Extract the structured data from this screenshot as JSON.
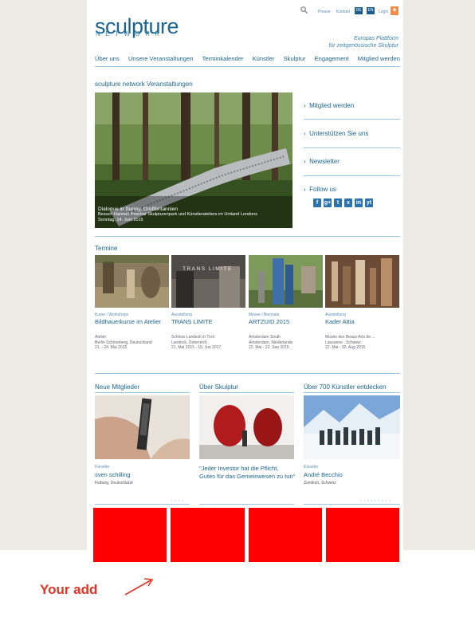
{
  "header": {
    "logo_main": "sculpture",
    "logo_sub": "NETWORK",
    "top_links": [
      "Presse",
      "Kontakt"
    ],
    "lang": [
      "DE",
      "EN"
    ],
    "login": "Login",
    "tagline_line1": "Europas Plattform",
    "tagline_line2": "für zeitgenössische Skulptur"
  },
  "nav": [
    "Über uns",
    "Unsere Veranstaltungen",
    "Terminkalender",
    "Künstler",
    "Skulptur",
    "Engagement",
    "Mitglied werden"
  ],
  "events": {
    "title": "sculpture network Veranstaltungen",
    "hero_title": "Dialogue in Surrey, Großbritannien",
    "hero_desc": "Besuch Hannah Peschar Skulpturenpark und Künstlerateliers im Umland Londons",
    "hero_date": "Sonntag, 14. Juni 2015"
  },
  "sidebar": {
    "items": [
      "Mitglied werden",
      "Unterstützen Sie uns",
      "Newsletter",
      "Follow us"
    ],
    "social": [
      "f",
      "g+",
      "t",
      "x",
      "in",
      "yt"
    ]
  },
  "termine": {
    "title": "Termine",
    "items": [
      {
        "cat": "Kurse / Workshops",
        "title": "Bildhauerkurse im Atelier",
        "meta1": "Atelier",
        "meta2": "Berlin Schöneberg, Deutschland",
        "meta3": "21. - 24. Mai 2015"
      },
      {
        "cat": "Ausstellung",
        "title": "TRANS LIMITE",
        "img_text": "TRANS LIMITE",
        "meta1": "Schloss Landeck in Tirol",
        "meta2": "Landeck, Österreich",
        "meta3": "21. Mai 2015 - 15. Jun 2017"
      },
      {
        "cat": "Messe / Biennale",
        "title": "ARTZUID 2015",
        "meta1": "Amsterdam South",
        "meta2": "Amsterdam, Niederlande",
        "meta3": "22. Mai - 22. Sep 2015"
      },
      {
        "cat": "Ausstellung",
        "title": "Kader Attia",
        "meta1": "Musée des Beaux Arts de ...",
        "meta2": "Lausanne , Schweiz",
        "meta3": "22. Mai - 30. Aug 2015"
      }
    ]
  },
  "columns": [
    {
      "title": "Neue Mitglieder",
      "cat": "Künstler",
      "name": "sven schilling",
      "meta": "freiburg, Deutschland",
      "dots": "• • • •"
    },
    {
      "title": "Über Skulptur",
      "quote1": "\"Jeder Investor hat die Pflicht,",
      "quote2": "Gutes für das Gemeinwesen zu tun\""
    },
    {
      "title": "Über 700 Künstler entdecken",
      "cat": "Künstler",
      "name": "André Becchio",
      "meta": "Zumikon, Schweiz",
      "dots": "• • • • • • • • •"
    }
  ],
  "ad": {
    "label": "Your add",
    "color": "#ff0000"
  }
}
